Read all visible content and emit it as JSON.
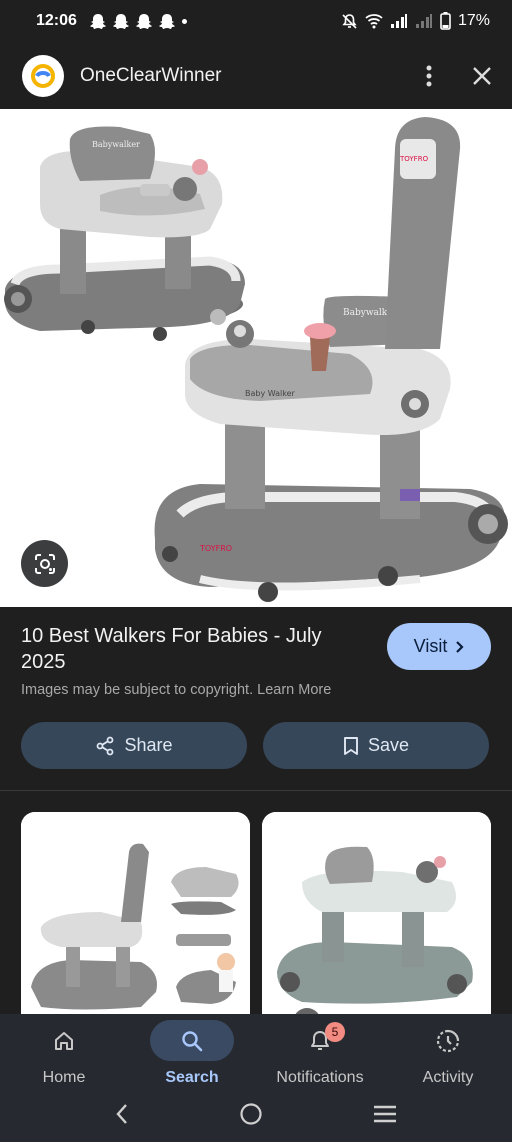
{
  "status": {
    "time": "12:06",
    "battery": "17%"
  },
  "header": {
    "site_name": "OneClearWinner"
  },
  "result": {
    "title": "10 Best Walkers For Babies - July 2025",
    "visit_label": "Visit",
    "copyright": "Images may be subject to copyright. Learn More",
    "share_label": "Share",
    "save_label": "Save"
  },
  "hero_image": {
    "brand_text_seat": "Babywalker",
    "brand_text_tray": "Baby Walker",
    "logo_text": "TOYFRO"
  },
  "nav": {
    "items": [
      {
        "label": "Home",
        "icon": "home-icon"
      },
      {
        "label": "Search",
        "icon": "search-icon",
        "active": true
      },
      {
        "label": "Notifications",
        "icon": "bell-icon",
        "badge": "5"
      },
      {
        "label": "Activity",
        "icon": "activity-icon"
      }
    ]
  },
  "colors": {
    "accent": "#a8c7fa",
    "surface": "#1f1f1f",
    "button": "#36475a",
    "badge": "#f28b82"
  }
}
